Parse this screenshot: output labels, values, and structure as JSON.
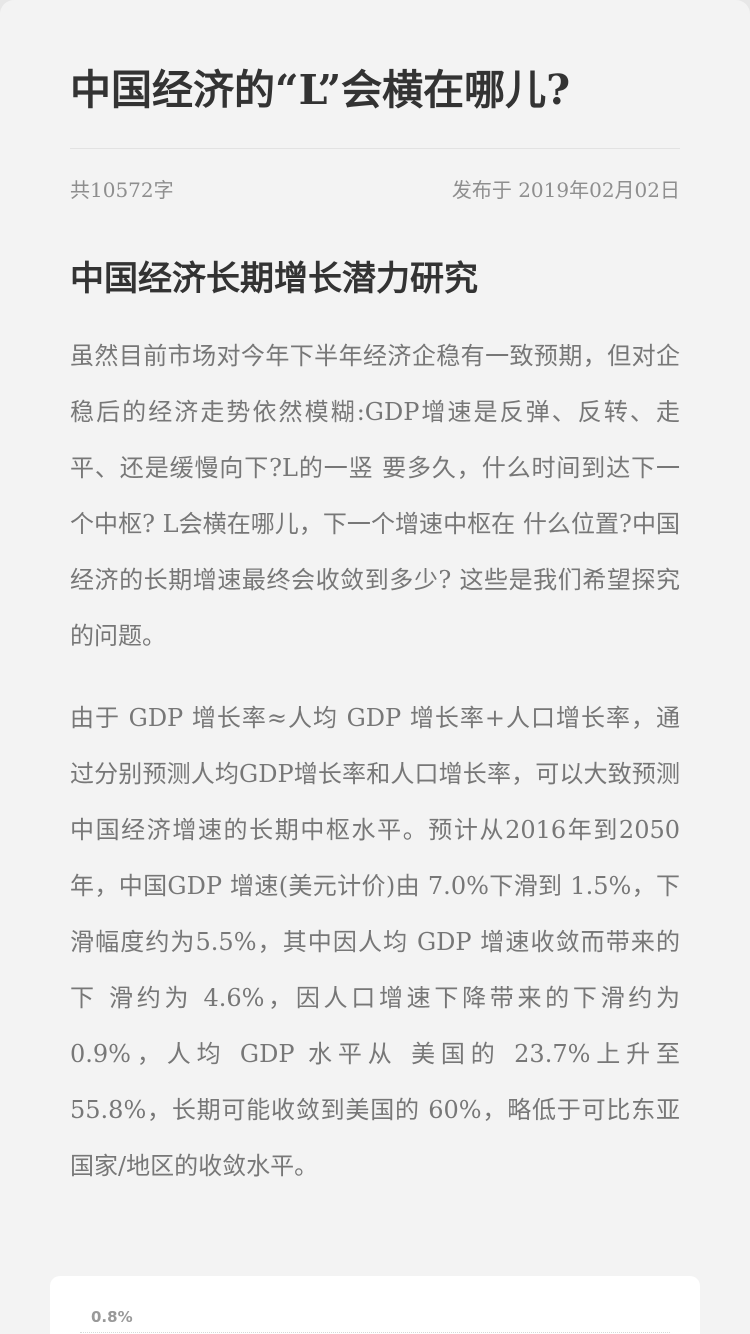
{
  "article": {
    "title": "中国经济的“L”会横在哪儿?",
    "meta": {
      "word_count": "共10572字",
      "published": "发布于 2019年02月02日"
    },
    "section_heading": "中国经济长期增长潜力研究",
    "paragraphs": [
      "虽然目前市场对今年下半年经济企稳有一致预期，但对企稳后的经济走势依然模糊:GDP增速是反弹、反转、走平、还是缓慢向下?L的一竖 要多久，什么时间到达下一个中枢? L会横在哪儿，下一个增速中枢在 什么位置?中国经济的长期增速最终会收敛到多少? 这些是我们希望探究的问题。",
      "由于 GDP 增长率≈人均 GDP 增长率+人口增长率，通过分别预测人均GDP增长率和人口增长率，可以大致预测中国经济增速的长期中枢水平。预计从2016年到2050年，中国GDP 增速(美元计价)由 7.0%下滑到 1.5%，下滑幅度约为5.5%，其中因人均 GDP 增速收敛而带来的下 滑约为 4.6%，因人口增速下降带来的下滑约为0.9%，人均 GDP 水平从 美国的 23.7%上升至 55.8%，长期可能收敛到美国的 60%，略低于可比东亚国家/地区的收敛水平。"
    ]
  },
  "chart": {
    "first_tick_label": "0.8%"
  }
}
